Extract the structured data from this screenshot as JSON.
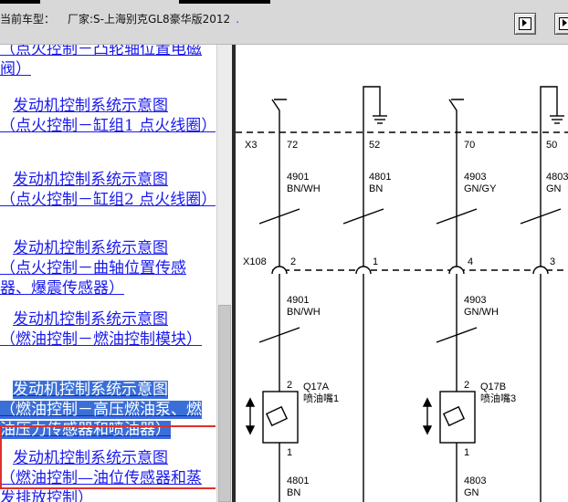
{
  "header": {
    "vehicle_label": "当前车型：",
    "vehicle_value": "厂家:S-上海别克GL8豪华版2012",
    "dot": "."
  },
  "toc": {
    "items": [
      {
        "title": "",
        "sub": "（点火控制－凸轮轴位置电磁阀）"
      },
      {
        "title": "发动机控制系统示意图",
        "sub": "（点火控制－缸组1 点火线圈）"
      },
      {
        "title": "发动机控制系统示意图",
        "sub": "（点火控制－缸组2 点火线圈）"
      },
      {
        "title": "发动机控制系统示意图",
        "sub": "（点火控制－曲轴位置传感器、爆震传感器）"
      },
      {
        "title": "发动机控制系统示意图",
        "sub": "（燃油控制－燃油控制模块）"
      },
      {
        "title": "发动机控制系统示意图",
        "sub": "（燃油控制－高压燃油泵、燃油压力传感器和喷油器）"
      },
      {
        "title": "发动机控制系统示意图",
        "sub": "（燃油控制—油位传感器和蒸发排放控制）"
      }
    ]
  },
  "diagram": {
    "connector_x3": "X3",
    "connector_x108": "X108",
    "x3_pins": [
      "72",
      "52",
      "70",
      "50"
    ],
    "x108_pins": [
      "2",
      "1",
      "4",
      "3"
    ],
    "wires_top": [
      {
        "circuit": "4901",
        "color": "BN/WH"
      },
      {
        "circuit": "4801",
        "color": "BN"
      },
      {
        "circuit": "4903",
        "color": "GN/GY"
      },
      {
        "circuit": "4803",
        "color": "GN"
      }
    ],
    "wires_mid": [
      {
        "circuit": "4901",
        "color": "BN/WH"
      },
      {
        "circuit": "4903",
        "color": "GN/WH"
      }
    ],
    "injectors": [
      {
        "id": "Q17A",
        "name": "喷油嘴1",
        "pin_top": "2",
        "pin_bottom": "1"
      },
      {
        "id": "Q17B",
        "name": "喷油嘴3",
        "pin_top": "2",
        "pin_bottom": "1"
      }
    ],
    "wires_bottom": [
      {
        "circuit": "4801",
        "color": "BN"
      },
      {
        "circuit": "4803",
        "color": "GN"
      }
    ]
  }
}
